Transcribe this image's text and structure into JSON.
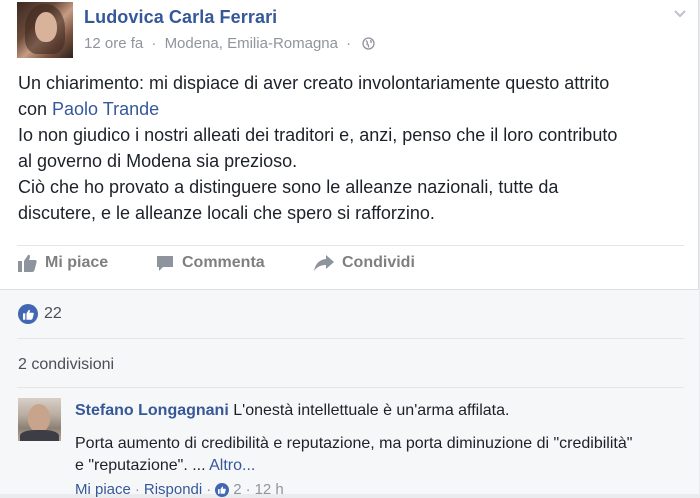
{
  "post": {
    "author": "Ludovica Carla Ferrari",
    "time": "12 ore fa",
    "separator": "·",
    "location": "Modena, Emilia-Romagna",
    "privacy_icon": "globe-icon",
    "line1": "Un chiarimento: mi dispiace di aver creato involontariamente questo attrito",
    "line2_prefix": "con ",
    "mention": "Paolo Trande",
    "line3": "Io non giudico i nostri alleati dei traditori e, anzi, penso che il loro contributo",
    "line4": "al governo di Modena sia prezioso.",
    "line5": "Ciò che ho provato a distinguere sono le alleanze nazionali, tutte da",
    "line6": "discutere, e le alleanze locali che spero si rafforzino."
  },
  "actions": {
    "like": "Mi piace",
    "comment": "Commenta",
    "share": "Condividi"
  },
  "reactions": {
    "count": "22"
  },
  "shares": {
    "label": "2 condivisioni"
  },
  "comment": {
    "author": "Stefano Longagnani",
    "text1": "L'onestà intellettuale è un'arma affilata.",
    "text2": "Porta aumento di credibilità e reputazione, ma porta diminuzione di \"credibilità\"",
    "text3": "e \"reputazione\". ...",
    "more": "Altro...",
    "footer_like": "Mi piace",
    "footer_sep": "·",
    "footer_reply": "Rispondi",
    "footer_likes": "2",
    "footer_time": "12 h"
  },
  "colors": {
    "link": "#365899",
    "like_badge": "#4267b2",
    "muted": "#90949c"
  }
}
